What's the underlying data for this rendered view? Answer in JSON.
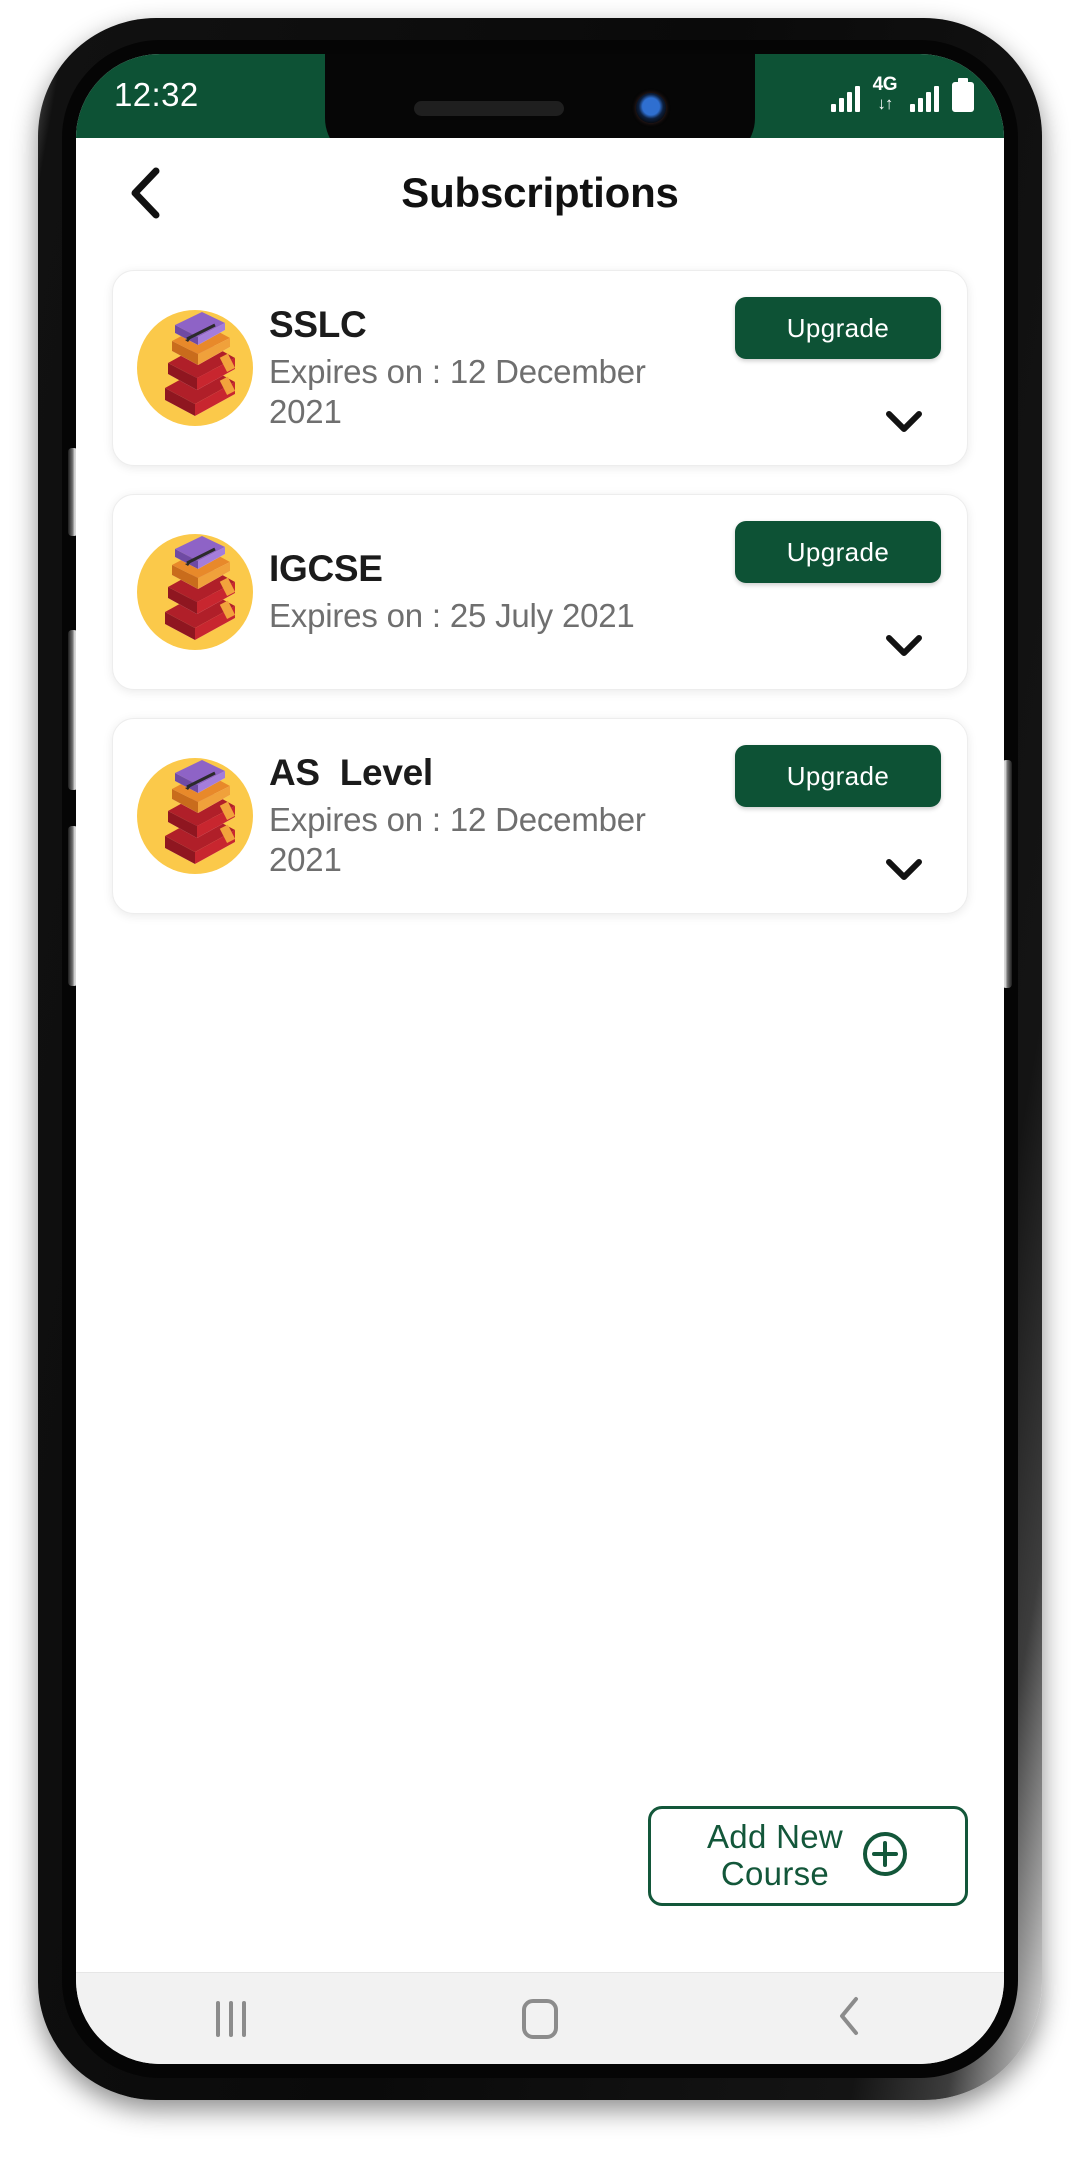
{
  "status_bar": {
    "time": "12:32",
    "network_type": "4G",
    "data_arrows": "↓↑",
    "icons": [
      "signal-bars-left",
      "network-4g",
      "signal-bars-right",
      "battery"
    ],
    "background_color": "#0d5235"
  },
  "header": {
    "back_icon": "chevron-left-icon",
    "title": "Subscriptions"
  },
  "theme": {
    "primary_green": "#0d5235",
    "border_green": "#13573a",
    "icon_circle": "#f7c948",
    "muted_text": "#6f6f6f"
  },
  "subscriptions": [
    {
      "name": "SSLC",
      "expiry": "Expires on : 12 December 2021",
      "action_label": "Upgrade",
      "icon": "book-stack-icon",
      "expand_icon": "chevron-down-icon"
    },
    {
      "name": "IGCSE",
      "expiry": "Expires on : 25 July 2021",
      "action_label": "Upgrade",
      "icon": "book-stack-icon",
      "expand_icon": "chevron-down-icon"
    },
    {
      "name": "AS  Level",
      "expiry": "Expires on : 12 December 2021",
      "action_label": "Upgrade",
      "icon": "book-stack-icon",
      "expand_icon": "chevron-down-icon"
    }
  ],
  "add_course": {
    "label": "Add New\nCourse",
    "icon": "plus-circle-icon"
  },
  "nav_bar": {
    "recents_label": "recents-icon",
    "home_label": "home-icon",
    "back_label": "back-icon"
  }
}
